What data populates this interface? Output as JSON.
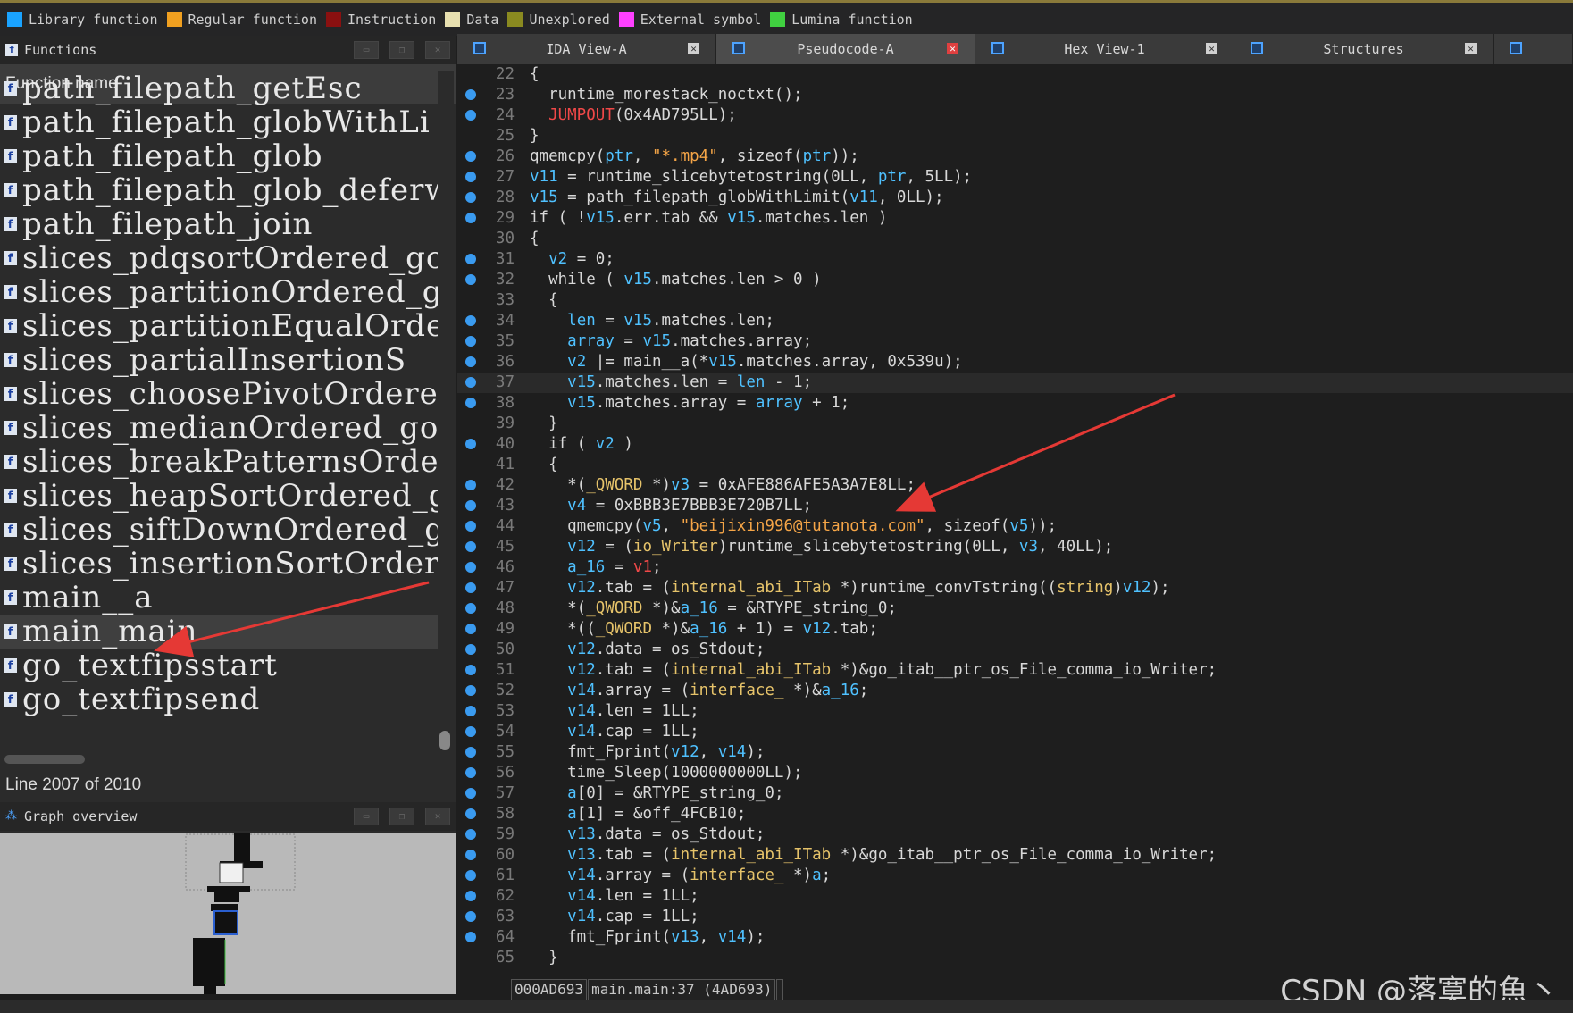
{
  "legend": [
    {
      "label": "Library function",
      "color": "#1aa3ff"
    },
    {
      "label": "Regular function",
      "color": "#f0a020"
    },
    {
      "label": "Instruction",
      "color": "#8a1010"
    },
    {
      "label": "Data",
      "color": "#e8e0b0"
    },
    {
      "label": "Unexplored",
      "color": "#8a8a20"
    },
    {
      "label": "External symbol",
      "color": "#ff40ff"
    },
    {
      "label": "Lumina function",
      "color": "#40d040"
    }
  ],
  "functions_panel": {
    "title": "Functions",
    "column_header": "Function name",
    "items": [
      "path_filepath_getEsc",
      "path_filepath_globWithLi",
      "path_filepath_glob",
      "path_filepath_glob_deferw",
      "path_filepath_join",
      "slices_pdqsortOrdered_go_",
      "slices_partitionOrdered_g",
      "slices_partitionEqualOrde",
      "slices_partialInsertionS",
      "slices_choosePivotOrdered",
      "slices_medianOrdered_go_s",
      "slices_breakPatternsOrder",
      "slices_heapSortOrdered_go",
      "slices_siftDownOrdered_go",
      "slices_insertionSortOrder",
      "main__a",
      "main_main",
      "go_textfipsstart",
      "go_textfipsend"
    ],
    "selected": "main_main",
    "line_info": "Line 2007 of 2010"
  },
  "graph_panel": {
    "title": "Graph overview"
  },
  "tabs": [
    {
      "label": "IDA View-A",
      "active": false
    },
    {
      "label": "Pseudocode-A",
      "active": true
    },
    {
      "label": "Hex View-1",
      "active": false
    },
    {
      "label": "Structures",
      "active": false
    }
  ],
  "code_lines": [
    {
      "n": "22",
      "dot": false,
      "html": "{"
    },
    {
      "n": "23",
      "dot": true,
      "html": "  runtime_morestack_noctxt();"
    },
    {
      "n": "24",
      "dot": true,
      "html": "  <span class='r'>JUMPOUT</span>(0x4AD795LL);"
    },
    {
      "n": "25",
      "dot": false,
      "html": "}"
    },
    {
      "n": "26",
      "dot": true,
      "html": "qmemcpy(<span class='v'>ptr</span>, <span class='s'>\"*.mp4\"</span>, sizeof(<span class='v'>ptr</span>));"
    },
    {
      "n": "27",
      "dot": true,
      "html": "<span class='v'>v11</span> = runtime_slicebytetostring(0LL, <span class='v'>ptr</span>, 5LL);"
    },
    {
      "n": "28",
      "dot": true,
      "html": "<span class='v'>v15</span> = path_filepath_globWithLimit(<span class='v'>v11</span>, 0LL);"
    },
    {
      "n": "29",
      "dot": true,
      "html": "if ( !<span class='v'>v15</span>.err.tab &amp;&amp; <span class='v'>v15</span>.matches.len )"
    },
    {
      "n": "30",
      "dot": false,
      "html": "{"
    },
    {
      "n": "31",
      "dot": true,
      "html": "  <span class='v'>v2</span> = 0;"
    },
    {
      "n": "32",
      "dot": true,
      "html": "  while ( <span class='v'>v15</span>.matches.len &gt; 0 )"
    },
    {
      "n": "33",
      "dot": false,
      "html": "  {"
    },
    {
      "n": "34",
      "dot": true,
      "html": "    <span class='v'>len</span> = <span class='v'>v15</span>.matches.len;"
    },
    {
      "n": "35",
      "dot": true,
      "html": "    <span class='v'>array</span> = <span class='v'>v15</span>.matches.array;"
    },
    {
      "n": "36",
      "dot": true,
      "html": "    <span class='v'>v2</span> |= main__a(*<span class='v'>v15</span>.matches.array, 0x539u);"
    },
    {
      "n": "37",
      "dot": true,
      "hl": true,
      "html": "    <span class='v'>v15</span>.matches.len = <span class='v'>len</span> - 1;"
    },
    {
      "n": "38",
      "dot": true,
      "html": "    <span class='v'>v15</span>.matches.array = <span class='v'>array</span> + 1;"
    },
    {
      "n": "39",
      "dot": false,
      "html": "  }"
    },
    {
      "n": "40",
      "dot": true,
      "html": "  if ( <span class='v'>v2</span> )"
    },
    {
      "n": "41",
      "dot": false,
      "html": "  {"
    },
    {
      "n": "42",
      "dot": true,
      "html": "    *(<span class='t'>_QWORD</span> *)<span class='v'>v3</span> = 0xAFE886AFE5A3A7E8LL;"
    },
    {
      "n": "43",
      "dot": true,
      "html": "    <span class='v'>v4</span> = 0xBBB3E7BBB3E720B7LL;"
    },
    {
      "n": "44",
      "dot": true,
      "html": "    qmemcpy(<span class='v'>v5</span>, <span class='s'>\"beijixin996@tutanota.com\"</span>, sizeof(<span class='v'>v5</span>));"
    },
    {
      "n": "45",
      "dot": true,
      "html": "    <span class='v'>v12</span> = (<span class='t'>io_Writer</span>)runtime_slicebytetostring(0LL, <span class='v'>v3</span>, 40LL);"
    },
    {
      "n": "46",
      "dot": true,
      "html": "    <span class='v'>a_16</span> = <span class='r'>v1</span>;"
    },
    {
      "n": "47",
      "dot": true,
      "html": "    <span class='v'>v12</span>.tab = (<span class='t'>internal_abi_ITab</span> *)runtime_convTstring((<span class='t'>string</span>)<span class='v'>v12</span>);"
    },
    {
      "n": "48",
      "dot": true,
      "html": "    *(<span class='t'>_QWORD</span> *)&amp;<span class='v'>a_16</span> = &amp;RTYPE_string_0;"
    },
    {
      "n": "49",
      "dot": true,
      "html": "    *((<span class='t'>_QWORD</span> *)&amp;<span class='v'>a_16</span> + 1) = <span class='v'>v12</span>.tab;"
    },
    {
      "n": "50",
      "dot": true,
      "html": "    <span class='v'>v12</span>.data = os_Stdout;"
    },
    {
      "n": "51",
      "dot": true,
      "html": "    <span class='v'>v12</span>.tab = (<span class='t'>internal_abi_ITab</span> *)&amp;go_itab__ptr_os_File_comma_io_Writer;"
    },
    {
      "n": "52",
      "dot": true,
      "html": "    <span class='v'>v14</span>.array = (<span class='t'>interface_</span> *)&amp;<span class='v'>a_16</span>;"
    },
    {
      "n": "53",
      "dot": true,
      "html": "    <span class='v'>v14</span>.len = 1LL;"
    },
    {
      "n": "54",
      "dot": true,
      "html": "    <span class='v'>v14</span>.cap = 1LL;"
    },
    {
      "n": "55",
      "dot": true,
      "html": "    fmt_Fprint(<span class='v'>v12</span>, <span class='v'>v14</span>);"
    },
    {
      "n": "56",
      "dot": true,
      "html": "    time_Sleep(1000000000LL);"
    },
    {
      "n": "57",
      "dot": true,
      "html": "    <span class='v'>a</span>[0] = &amp;RTYPE_string_0;"
    },
    {
      "n": "58",
      "dot": true,
      "html": "    <span class='v'>a</span>[1] = &amp;off_4FCB10;"
    },
    {
      "n": "59",
      "dot": true,
      "html": "    <span class='v'>v13</span>.data = os_Stdout;"
    },
    {
      "n": "60",
      "dot": true,
      "html": "    <span class='v'>v13</span>.tab = (<span class='t'>internal_abi_ITab</span> *)&amp;go_itab__ptr_os_File_comma_io_Writer;"
    },
    {
      "n": "61",
      "dot": true,
      "html": "    <span class='v'>v14</span>.array = (<span class='t'>interface_</span> *)<span class='v'>a</span>;"
    },
    {
      "n": "62",
      "dot": true,
      "html": "    <span class='v'>v14</span>.len = 1LL;"
    },
    {
      "n": "63",
      "dot": true,
      "html": "    <span class='v'>v14</span>.cap = 1LL;"
    },
    {
      "n": "64",
      "dot": true,
      "html": "    fmt_Fprint(<span class='v'>v13</span>, <span class='v'>v14</span>);"
    },
    {
      "n": "65",
      "dot": false,
      "html": "  }"
    }
  ],
  "status_bar": {
    "address": "000AD693",
    "location": "main.main:37 (4AD693)"
  },
  "watermark": "CSDN @落寞的魚丶"
}
